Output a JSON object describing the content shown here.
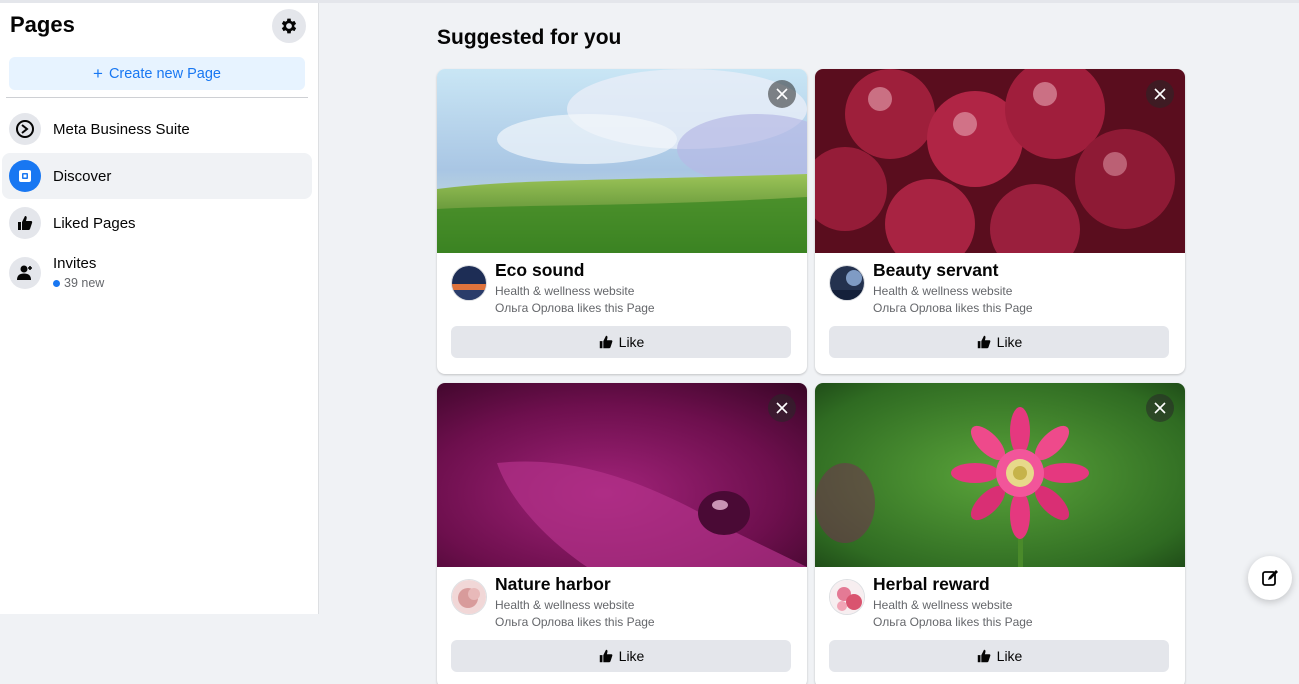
{
  "sidebar": {
    "title": "Pages",
    "create_label": "Create new Page",
    "items": [
      {
        "label": "Meta Business Suite"
      },
      {
        "label": "Discover"
      },
      {
        "label": "Liked Pages"
      },
      {
        "label": "Invites",
        "sub": "39 new"
      }
    ]
  },
  "main": {
    "section_title": "Suggested for you",
    "cards": [
      {
        "name": "Eco sound",
        "category": "Health & wellness website",
        "social": "Ольга Орлова likes this Page",
        "like_label": "Like"
      },
      {
        "name": "Beauty servant",
        "category": "Health & wellness website",
        "social": "Ольга Орлова likes this Page",
        "like_label": "Like"
      },
      {
        "name": "Nature harbor",
        "category": "Health & wellness website",
        "social": "Ольга Орлова likes this Page",
        "like_label": "Like"
      },
      {
        "name": "Herbal reward",
        "category": "Health & wellness website",
        "social": "Ольга Орлова likes this Page",
        "like_label": "Like"
      }
    ]
  },
  "icons": {
    "settings": "gear-icon",
    "meta_business_suite": "meta-business-suite-icon",
    "discover": "discover-icon",
    "liked_pages": "thumbs-up-icon",
    "invites": "add-person-icon",
    "close": "close-icon",
    "like": "thumbs-up-icon",
    "compose": "compose-icon"
  },
  "colors": {
    "accent": "#1877f2",
    "background": "#f0f2f5"
  }
}
